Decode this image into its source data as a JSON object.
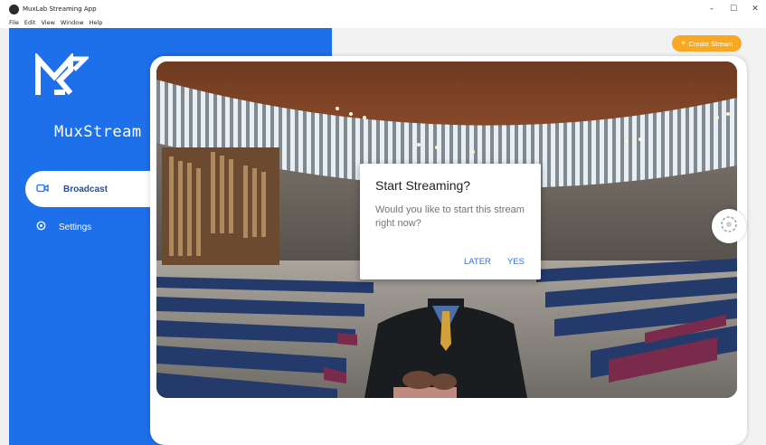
{
  "window": {
    "title": "MuxLab Streaming App",
    "controls": {
      "minimize": "–",
      "maximize": "☐",
      "close": "✕"
    }
  },
  "menu": [
    "File",
    "Edit",
    "View",
    "Window",
    "Help"
  ],
  "sidebar": {
    "brand": "MuxStream",
    "items": [
      {
        "label": "Broadcast",
        "icon": "video-camera-icon",
        "active": true
      },
      {
        "label": "Settings",
        "icon": "gear-icon",
        "active": false
      }
    ]
  },
  "toolbar": {
    "create_label": "Create Stream",
    "create_icon": "+"
  },
  "dialog": {
    "title": "Start Streaming?",
    "message": "Would you like to start this stream right now?",
    "later": "LATER",
    "yes": "YES"
  },
  "colors": {
    "brand_blue": "#1e6fea",
    "accent_orange": "#f9a825",
    "dialog_button": "#2b6fe0"
  }
}
